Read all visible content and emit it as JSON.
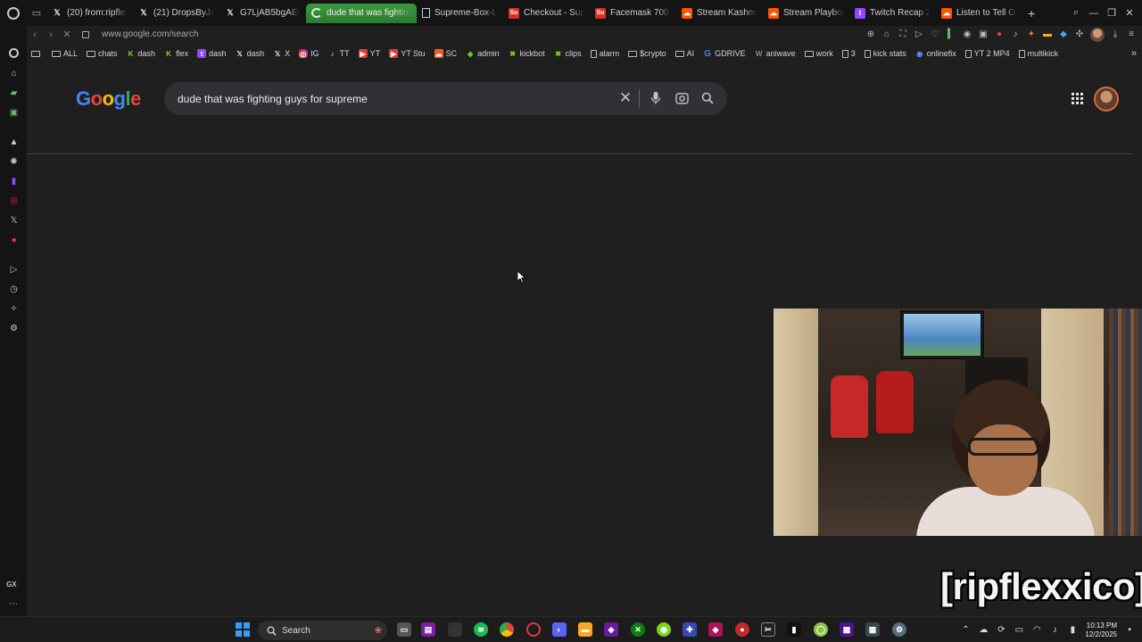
{
  "browser": {
    "tabs": [
      {
        "label": "(20) from:ripflexx",
        "icon": "x-icon",
        "active": false
      },
      {
        "label": "(21) DropsByJay",
        "icon": "x-icon",
        "active": false
      },
      {
        "label": "G7LjAB5bgAEodc",
        "icon": "x-icon",
        "active": false
      },
      {
        "label": "dude that was fighting g",
        "icon": "loading-icon",
        "active": true
      },
      {
        "label": "Supreme-Box-Lo",
        "icon": "document-icon",
        "active": false
      },
      {
        "label": "Checkout - Supre",
        "icon": "supreme-icon",
        "active": false
      },
      {
        "label": "Facemask 700-F",
        "icon": "supreme-icon",
        "active": false
      },
      {
        "label": "Stream Kashmir",
        "icon": "soundcloud-icon",
        "active": false
      },
      {
        "label": "Stream Playboi C",
        "icon": "soundcloud-icon",
        "active": false
      },
      {
        "label": "Twitch Recap 202",
        "icon": "twitch-icon",
        "active": false
      },
      {
        "label": "Listen to Tell On",
        "icon": "soundcloud-icon",
        "active": false
      }
    ],
    "url": "www.google.com/search"
  },
  "bookmarks": [
    {
      "label": "",
      "icon": "folder-icon"
    },
    {
      "label": "ALL",
      "icon": "folder-icon"
    },
    {
      "label": "chats",
      "icon": "folder-icon"
    },
    {
      "label": "dash",
      "icon": "kick-icon"
    },
    {
      "label": "flex",
      "icon": "kick-icon"
    },
    {
      "label": "dash",
      "icon": "twitch-icon"
    },
    {
      "label": "dash",
      "icon": "x-icon"
    },
    {
      "label": "X",
      "icon": "x-icon"
    },
    {
      "label": "IG",
      "icon": "instagram-icon"
    },
    {
      "label": "TT",
      "icon": "tiktok-icon"
    },
    {
      "label": "YT",
      "icon": "youtube-icon"
    },
    {
      "label": "YT Stu",
      "icon": "youtube-icon"
    },
    {
      "label": "SC",
      "icon": "soundcloud-icon"
    },
    {
      "label": "admin",
      "icon": "shopify-icon"
    },
    {
      "label": "kickbot",
      "icon": "kick-icon"
    },
    {
      "label": "clips",
      "icon": "kick-icon"
    },
    {
      "label": "alarm",
      "icon": "document-icon"
    },
    {
      "label": "$crypto",
      "icon": "folder-icon"
    },
    {
      "label": "AI",
      "icon": "folder-icon"
    },
    {
      "label": "GDRIVE",
      "icon": "google-icon"
    },
    {
      "label": "aniwave",
      "icon": "w-icon"
    },
    {
      "label": "work",
      "icon": "folder-icon"
    },
    {
      "label": "3",
      "icon": "document-icon"
    },
    {
      "label": "kick stats",
      "icon": "document-icon"
    },
    {
      "label": "onlinefix",
      "icon": "globe-icon"
    },
    {
      "label": "YT 2 MP4",
      "icon": "document-icon"
    },
    {
      "label": "multikick",
      "icon": "document-icon"
    }
  ],
  "google": {
    "logo_text": [
      "G",
      "o",
      "o",
      "g",
      "l",
      "e"
    ],
    "query": "dude that was fighting guys for supreme"
  },
  "overlay": {
    "streamer_tag": "[ripflexxico]"
  },
  "taskbar": {
    "search_placeholder": "Search",
    "time": "10:13 PM",
    "date": "12/2/2025"
  },
  "sidebar": {
    "gx_label": "GX"
  }
}
